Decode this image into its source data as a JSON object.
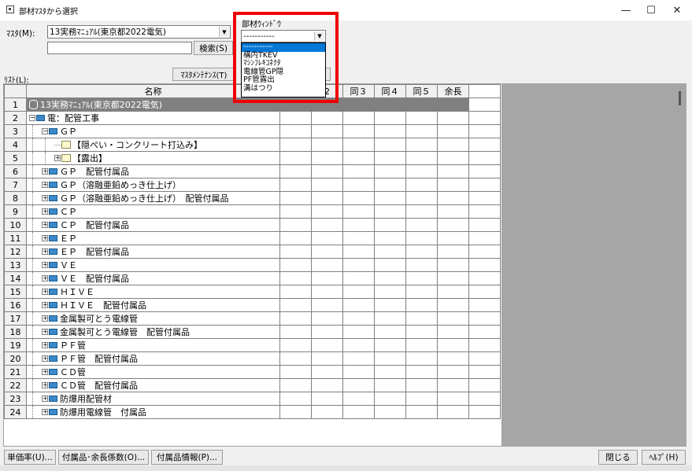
{
  "window": {
    "title": "部材ﾏｽﾀから選択",
    "minimize": "—",
    "maximize": "☐",
    "close": "✕"
  },
  "toolbar": {
    "master_label": "ﾏｽﾀ(M):",
    "master_value": "13実務ﾏﾆｭｱﾙ(東京都2022電気)",
    "search_value": "",
    "search_button": "検索(S)",
    "maintenance_button": "ﾏｽﾀﾒﾝﾃﾅﾝｽ(T)",
    "list_label": "ﾘｽﾄ(L):"
  },
  "buzai_window": {
    "label": "部材ｳｨﾝﾄﾞｳ",
    "selected_value": "-----------",
    "options": [
      "-----------",
      "構内TKEV",
      "ﾏｼﾝﾌﾚｷｺﾈｸﾀ",
      "電線管GP隠",
      "PF管露出",
      "溝はつり"
    ],
    "highlight_color": "#ee0000"
  },
  "grid": {
    "columns": [
      "名称",
      "2",
      "同３",
      "同４",
      "同５",
      "余長"
    ],
    "rows": [
      {
        "num": "1",
        "level": 0,
        "expander": "",
        "icon": "db-icon",
        "name": "13実務ﾏﾆｭｱﾙ(東京都2022電気)",
        "selected": true
      },
      {
        "num": "2",
        "level": 0,
        "expander": "-",
        "icon": "folder-icon",
        "name": "電：配管工事"
      },
      {
        "num": "3",
        "level": 1,
        "expander": "-",
        "icon": "folder-icon",
        "name": "ＧＰ"
      },
      {
        "num": "4",
        "level": 2,
        "expander": "",
        "icon": "doc-icon",
        "name": "【隠ぺい・コンクリート打込み】"
      },
      {
        "num": "5",
        "level": 2,
        "expander": "+",
        "icon": "doc-icon",
        "name": "【露出】"
      },
      {
        "num": "6",
        "level": 1,
        "expander": "+",
        "icon": "folder-icon",
        "name": "ＧＰ　配管付属品"
      },
      {
        "num": "7",
        "level": 1,
        "expander": "+",
        "icon": "folder-icon",
        "name": "ＧＰ（溶融亜鉛めっき仕上げ）"
      },
      {
        "num": "8",
        "level": 1,
        "expander": "+",
        "icon": "folder-icon",
        "name": "ＧＰ（溶融亜鉛めっき仕上げ）　配管付属品"
      },
      {
        "num": "9",
        "level": 1,
        "expander": "+",
        "icon": "folder-icon",
        "name": "ＣＰ"
      },
      {
        "num": "10",
        "level": 1,
        "expander": "+",
        "icon": "folder-icon",
        "name": "ＣＰ　配管付属品"
      },
      {
        "num": "11",
        "level": 1,
        "expander": "+",
        "icon": "folder-icon",
        "name": "ＥＰ"
      },
      {
        "num": "12",
        "level": 1,
        "expander": "+",
        "icon": "folder-icon",
        "name": "ＥＰ　配管付属品"
      },
      {
        "num": "13",
        "level": 1,
        "expander": "+",
        "icon": "folder-icon",
        "name": "ＶＥ"
      },
      {
        "num": "14",
        "level": 1,
        "expander": "+",
        "icon": "folder-icon",
        "name": "ＶＥ　配管付属品"
      },
      {
        "num": "15",
        "level": 1,
        "expander": "+",
        "icon": "folder-icon",
        "name": "ＨＩＶＥ"
      },
      {
        "num": "16",
        "level": 1,
        "expander": "+",
        "icon": "folder-icon",
        "name": "ＨＩＶＥ　配管付属品"
      },
      {
        "num": "17",
        "level": 1,
        "expander": "+",
        "icon": "folder-icon",
        "name": "金属製可とう電線管"
      },
      {
        "num": "18",
        "level": 1,
        "expander": "+",
        "icon": "folder-icon",
        "name": "金属製可とう電線管　配管付属品"
      },
      {
        "num": "19",
        "level": 1,
        "expander": "+",
        "icon": "folder-icon",
        "name": "ＰＦ管"
      },
      {
        "num": "20",
        "level": 1,
        "expander": "+",
        "icon": "folder-icon",
        "name": "ＰＦ管　配管付属品"
      },
      {
        "num": "21",
        "level": 1,
        "expander": "+",
        "icon": "folder-icon",
        "name": "ＣＤ管"
      },
      {
        "num": "22",
        "level": 1,
        "expander": "+",
        "icon": "folder-icon",
        "name": "ＣＤ管　配管付属品"
      },
      {
        "num": "23",
        "level": 1,
        "expander": "+",
        "icon": "folder-icon",
        "name": "防爆用配管材"
      },
      {
        "num": "24",
        "level": 1,
        "expander": "+",
        "icon": "folder-icon",
        "name": "防爆用電線管　付属品"
      }
    ]
  },
  "footer": {
    "unit_price_button": "単価率(U)...",
    "accessory_button": "付属品･余長係数(O)...",
    "accessory_info_button": "付属品情報(P)...",
    "close_button": "閉じる",
    "help_button": "ﾍﾙﾌﾟ(H)"
  }
}
